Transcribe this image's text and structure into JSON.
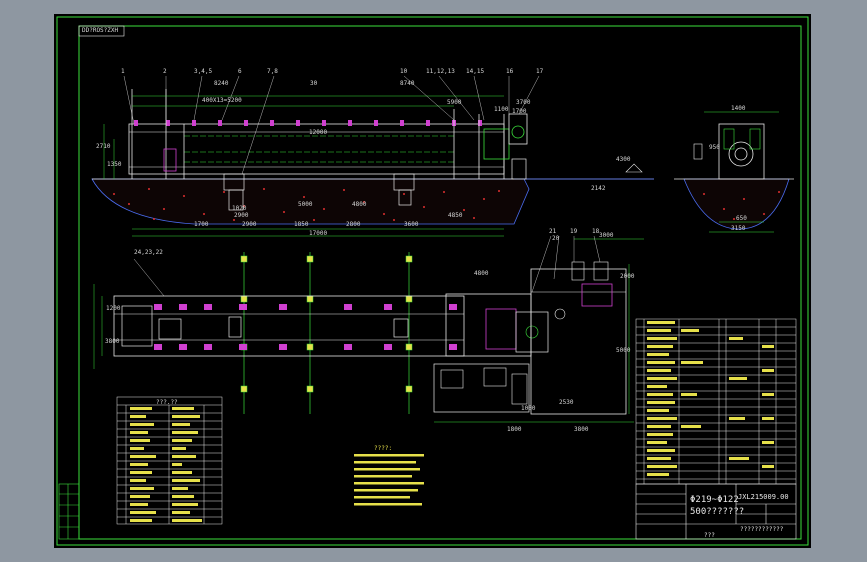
{
  "drawing": {
    "corner_label": "DD?ROS?ZXH",
    "part_numbers_top": [
      "1",
      "2",
      "3,4,5",
      "6",
      "7,8",
      "10",
      "11,12,13",
      "14,15",
      "16",
      "17"
    ],
    "part_numbers_plan": [
      "24,23,22",
      "21",
      "20",
      "19",
      "18"
    ],
    "dims_top": [
      "8240",
      "400X13=5200",
      "30",
      "8740",
      "12000",
      "1100",
      "5900",
      "3700",
      "1700"
    ],
    "dims_bottom": [
      "1020",
      "2900",
      "5000",
      "4800",
      "1700",
      "2900",
      "1850",
      "2800",
      "3600",
      "4850",
      "17000"
    ],
    "dims_left": [
      "2710",
      "1350"
    ],
    "dims_side": [
      "1400",
      "950",
      "3150",
      "650",
      "2142",
      "4300"
    ],
    "dims_plan": [
      "3000",
      "4800",
      "2000",
      "1200",
      "3800",
      "1800",
      "3800",
      "1000",
      "2530",
      "5000"
    ],
    "spec_title": "???.??",
    "notes_title": "????:"
  },
  "title_block": {
    "title_line1": "Φ219~Φ122",
    "title_line2": "500???????",
    "drawing_no": "JXL215009.00",
    "footer": "???",
    "company": "????????????"
  },
  "colors": {
    "sheet_bg": "#000000",
    "frame": "#3be03b",
    "line": "#e8e8e8",
    "accent_yellow": "#e6e04a",
    "accent_magenta": "#d040d0",
    "accent_red": "#e03030",
    "accent_blue": "#4a6cf0"
  }
}
